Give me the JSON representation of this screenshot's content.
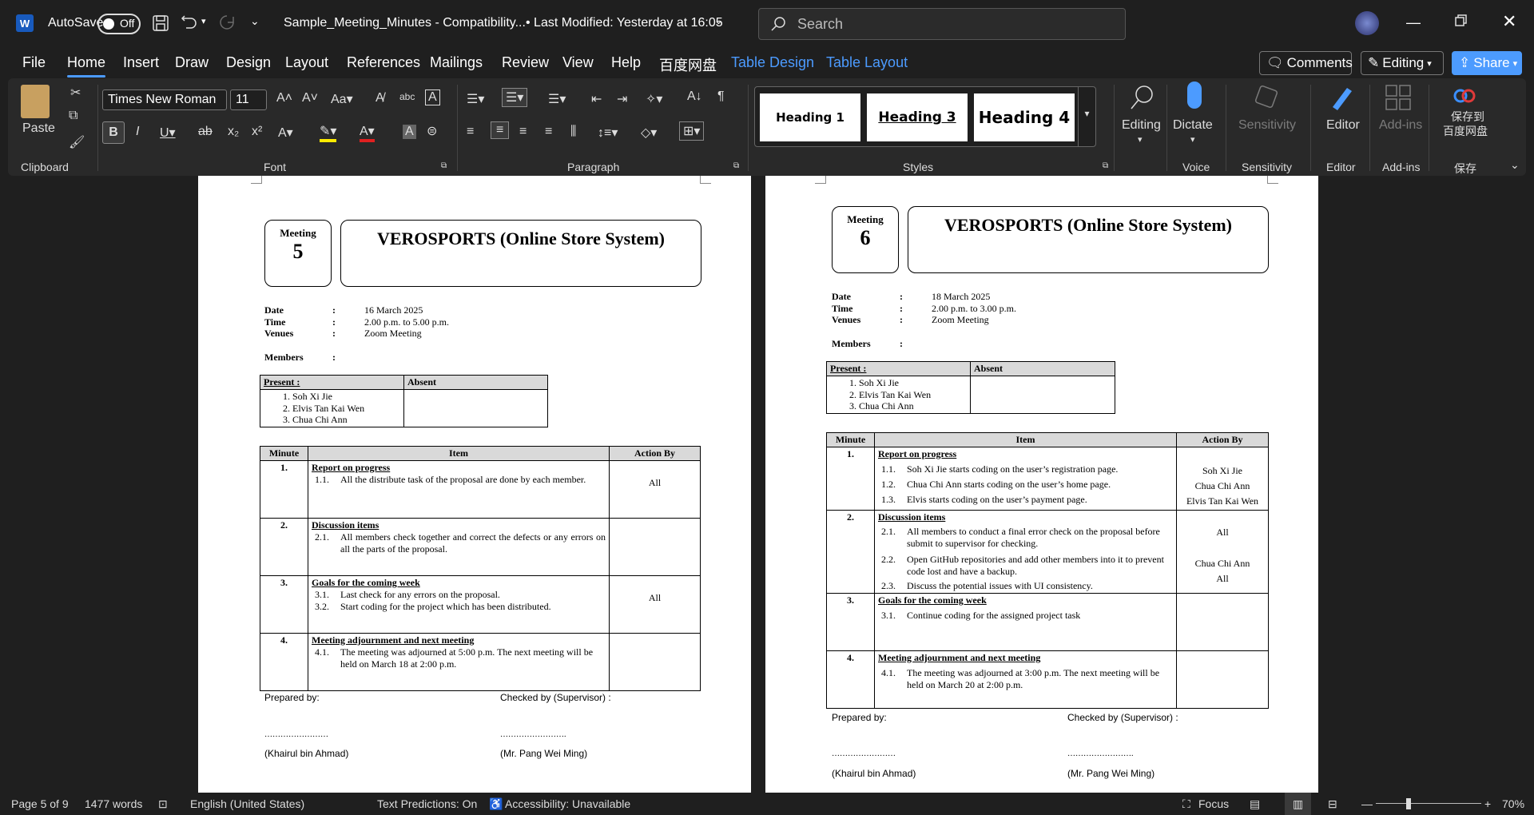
{
  "titlebar": {
    "autosave_label": "AutoSave",
    "autosave_state": "Off",
    "doc_title": "Sample_Meeting_Minutes  -  Compatibility...",
    "modified": "•  Last Modified: Yesterday at 16:05",
    "search_placeholder": "Search"
  },
  "menu": [
    "File",
    "Home",
    "Insert",
    "Draw",
    "Design",
    "Layout",
    "References",
    "Mailings",
    "Review",
    "View",
    "Help",
    "百度网盘",
    "Table Design",
    "Table Layout"
  ],
  "header_buttons": {
    "comments": "Comments",
    "editing": "Editing",
    "share": "Share"
  },
  "ribbon": {
    "clipboard": {
      "paste": "Paste",
      "label": "Clipboard"
    },
    "font": {
      "name": "Times New Roman",
      "size": "11",
      "label": "Font"
    },
    "paragraph": {
      "label": "Paragraph"
    },
    "styles": {
      "label": "Styles",
      "items": [
        "Heading 1",
        "Heading 3",
        "Heading 4"
      ]
    },
    "editing": {
      "label": "Editing"
    },
    "voice": {
      "dictate": "Dictate",
      "label": "Voice"
    },
    "sensitivity": {
      "button": "Sensitivity",
      "label": "Sensitivity"
    },
    "editor": {
      "button": "Editor",
      "label": "Editor"
    },
    "addins": {
      "button": "Add-ins",
      "label": "Add-ins"
    },
    "save": {
      "button_line1": "保存到",
      "button_line2": "百度网盘",
      "label": "保存"
    }
  },
  "pages": [
    {
      "meeting_label": "Meeting",
      "meeting_no": "5",
      "title": "VEROSPORTS (Online Store System)",
      "date_label": "Date",
      "date": "16 March 2025",
      "time_label": "Time",
      "time": "2.00 p.m. to 5.00 p.m.",
      "venue_label": "Venues",
      "venue": "Zoom Meeting",
      "members_label": "Members",
      "present_header": "Present :",
      "absent_header": "Absent",
      "present": [
        "1.    Soh Xi Jie",
        "2.    Elvis Tan Kai Wen",
        "3.    Chua Chi Ann"
      ],
      "headers": {
        "minute": "Minute",
        "item": "Item",
        "action": "Action By"
      },
      "rows": [
        {
          "no": "1.",
          "title": "Report on progress",
          "subs": [
            {
              "n": "1.1.",
              "t": "All the distribute task of the proposal are done by each member."
            }
          ],
          "actions": [
            "All"
          ]
        },
        {
          "no": "2.",
          "title": "Discussion items",
          "subs": [
            {
              "n": "2.1.",
              "t": "All members check together and correct the defects or any errors on all the parts of the proposal."
            }
          ],
          "actions": []
        },
        {
          "no": "3.",
          "title": "Goals for the coming week",
          "subs": [
            {
              "n": "3.1.",
              "t": "Last check  for any errors on the proposal."
            },
            {
              "n": "3.2.",
              "t": "Start coding for the project which has been distributed."
            }
          ],
          "actions": [
            "All"
          ]
        },
        {
          "no": "4.",
          "title": "Meeting adjournment and next meeting",
          "subs": [
            {
              "n": "4.1.",
              "t": "The meeting was adjourned at 5:00 p.m. The next meeting will be held on March 18 at 2:00 p.m."
            }
          ],
          "actions": []
        }
      ],
      "prepared_by": "Prepared by:",
      "checked_by": "Checked by (Supervisor) :",
      "dots": "……………………",
      "dots2": "…………………….",
      "preparer": "(Khairul bin Ahmad)",
      "supervisor": "(Mr. Pang Wei Ming)"
    },
    {
      "meeting_label": "Meeting",
      "meeting_no": "6",
      "title": "VEROSPORTS (Online Store System)",
      "date_label": "Date",
      "date": "18 March 2025",
      "time_label": "Time",
      "time": "2.00 p.m. to 3.00 p.m.",
      "venue_label": "Venues",
      "venue": "Zoom Meeting",
      "members_label": "Members",
      "present_header": "Present :",
      "absent_header": "Absent",
      "present": [
        "1.    Soh Xi Jie",
        "2.    Elvis Tan Kai Wen",
        "3.    Chua Chi Ann"
      ],
      "headers": {
        "minute": "Minute",
        "item": "Item",
        "action": "Action By"
      },
      "rows": [
        {
          "no": "1.",
          "title": "Report on progress",
          "subs": [
            {
              "n": "1.1.",
              "t": "Soh Xi Jie starts coding on the user’s registration page."
            },
            {
              "n": "1.2.",
              "t": "Chua Chi Ann starts coding on the user’s home page."
            },
            {
              "n": "1.3.",
              "t": "Elvis starts coding on the user’s payment page."
            }
          ],
          "actions": [
            "Soh Xi Jie",
            "Chua Chi Ann",
            "Elvis Tan Kai Wen"
          ]
        },
        {
          "no": "2.",
          "title": "Discussion items",
          "subs": [
            {
              "n": "2.1.",
              "t": "All members to conduct a final error check on the proposal before submit to supervisor for checking."
            },
            {
              "n": "2.2.",
              "t": "Open GitHub repositories and add other members into it to prevent code lost and have a backup."
            },
            {
              "n": "2.3.",
              "t": "Discuss the potential issues with UI consistency."
            }
          ],
          "actions": [
            "All",
            "Chua Chi Ann",
            "All"
          ]
        },
        {
          "no": "3.",
          "title": "Goals for the coming week",
          "subs": [
            {
              "n": "3.1.",
              "t": "Continue coding for the assigned project task"
            }
          ],
          "actions": []
        },
        {
          "no": "4.",
          "title": "Meeting adjournment and next meeting",
          "subs": [
            {
              "n": "4.1.",
              "t": "The meeting was adjourned at 3:00 p.m. The next meeting will be held on March 20 at 2:00 p.m."
            }
          ],
          "actions": []
        }
      ],
      "prepared_by": "Prepared by:",
      "checked_by": "Checked by (Supervisor) :",
      "dots": "……………………",
      "dots2": "…………………….",
      "preparer": "(Khairul bin Ahmad)",
      "supervisor": "(Mr. Pang Wei Ming)"
    }
  ],
  "status": {
    "page": "Page 5 of 9",
    "words": "1477 words",
    "language": "English (United States)",
    "predictions": "Text Predictions: On",
    "accessibility": "Accessibility: Unavailable",
    "focus": "Focus",
    "zoom": "70%"
  },
  "colors": {
    "accent": "#4c9bff",
    "share": "#4c9bff"
  }
}
